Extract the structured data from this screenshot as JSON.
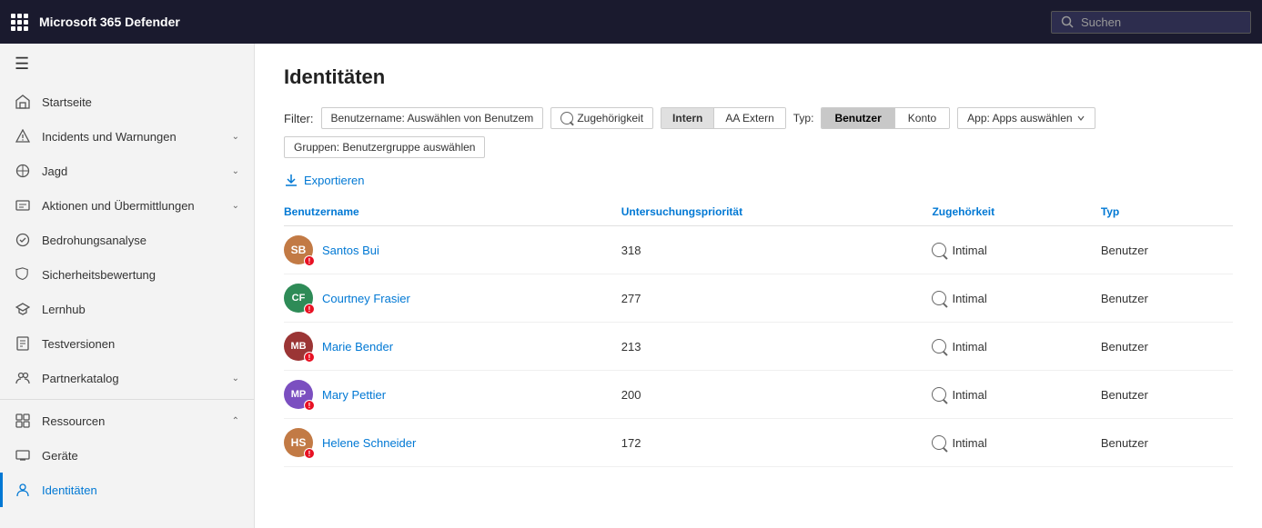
{
  "topbar": {
    "app_name": "Microsoft 365 Defender",
    "search_placeholder": "Suchen"
  },
  "sidebar": {
    "hamburger_label": "≡",
    "items": [
      {
        "id": "startseite",
        "label": "Startseite",
        "icon": "home",
        "has_chevron": false,
        "active": false
      },
      {
        "id": "incidents",
        "label": "Incidents und Warnungen",
        "icon": "alert",
        "has_chevron": true,
        "active": false
      },
      {
        "id": "jagd",
        "label": "Jagd",
        "icon": "hunt",
        "has_chevron": true,
        "active": false
      },
      {
        "id": "aktionen",
        "label": "Aktionen und Übermittlungen",
        "icon": "actions",
        "has_chevron": true,
        "active": false
      },
      {
        "id": "bedrohung",
        "label": "Bedrohungsanalyse",
        "icon": "threat",
        "has_chevron": false,
        "active": false
      },
      {
        "id": "sicherheit",
        "label": "Sicherheitsbewertung",
        "icon": "security",
        "has_chevron": false,
        "active": false
      },
      {
        "id": "lernhub",
        "label": "Lernhub",
        "icon": "learn",
        "has_chevron": false,
        "active": false
      },
      {
        "id": "testversionen",
        "label": "Testversionen",
        "icon": "test",
        "has_chevron": false,
        "active": false
      },
      {
        "id": "partner",
        "label": "Partnerkatalog",
        "icon": "partner",
        "has_chevron": true,
        "active": false
      },
      {
        "id": "ressourcen",
        "label": "Ressourcen",
        "icon": "resources",
        "has_chevron": true,
        "active": false
      },
      {
        "id": "geraete",
        "label": "Geräte",
        "icon": "devices",
        "has_chevron": false,
        "active": false
      },
      {
        "id": "identitaeten",
        "label": "Identitäten",
        "icon": "identity",
        "has_chevron": false,
        "active": true
      }
    ]
  },
  "page": {
    "title": "Identitäten",
    "filter_label": "Filter:",
    "filter_benutzername": "Benutzername: Auswählen von Benutzem",
    "filter_zugehorigkeit": "Zugehörigkeit",
    "filter_intern": "Intern",
    "filter_aa_extern": "AA Extern",
    "filter_typ_label": "Typ:",
    "filter_benutzer": "Benutzer",
    "filter_konto": "Konto",
    "filter_app": "App: Apps auswählen",
    "filter_gruppen": "Gruppen: Benutzergruppe auswählen",
    "export_label": "Exportieren",
    "columns": {
      "benutzername": "Benutzername",
      "untersuchungsprioritaet": "Untersuchungspriorität",
      "zugehorigkeit": "Zugehörkeit",
      "typ": "Typ"
    },
    "users": [
      {
        "name": "Santos Bui",
        "initials": "SB",
        "color": "#8b4513",
        "priority": 318,
        "zugehorigkeit": "Intimal",
        "typ": "Benutzer",
        "has_photo": true,
        "photo_color": "#a0522d"
      },
      {
        "name": "Courtney Frasier",
        "initials": "CF",
        "color": "#2e8b57",
        "priority": 277,
        "zugehorigkeit": "Intimal",
        "typ": "Benutzer",
        "has_photo": false
      },
      {
        "name": "Marie Bender",
        "initials": "MB",
        "color": "#8b4545",
        "priority": 213,
        "zugehorigkeit": "Intimal",
        "typ": "Benutzer",
        "has_photo": false
      },
      {
        "name": "Mary Pettier",
        "initials": "MP",
        "color": "#6b3fa0",
        "priority": 200,
        "zugehorigkeit": "Intimal",
        "typ": "Benutzer",
        "has_photo": false
      },
      {
        "name": "Helene Schneider",
        "initials": "HS",
        "color": "#8b4513",
        "priority": 172,
        "zugehorigkeit": "Intimal",
        "typ": "Benutzer",
        "has_photo": true,
        "photo_color": "#a0522d"
      }
    ]
  }
}
